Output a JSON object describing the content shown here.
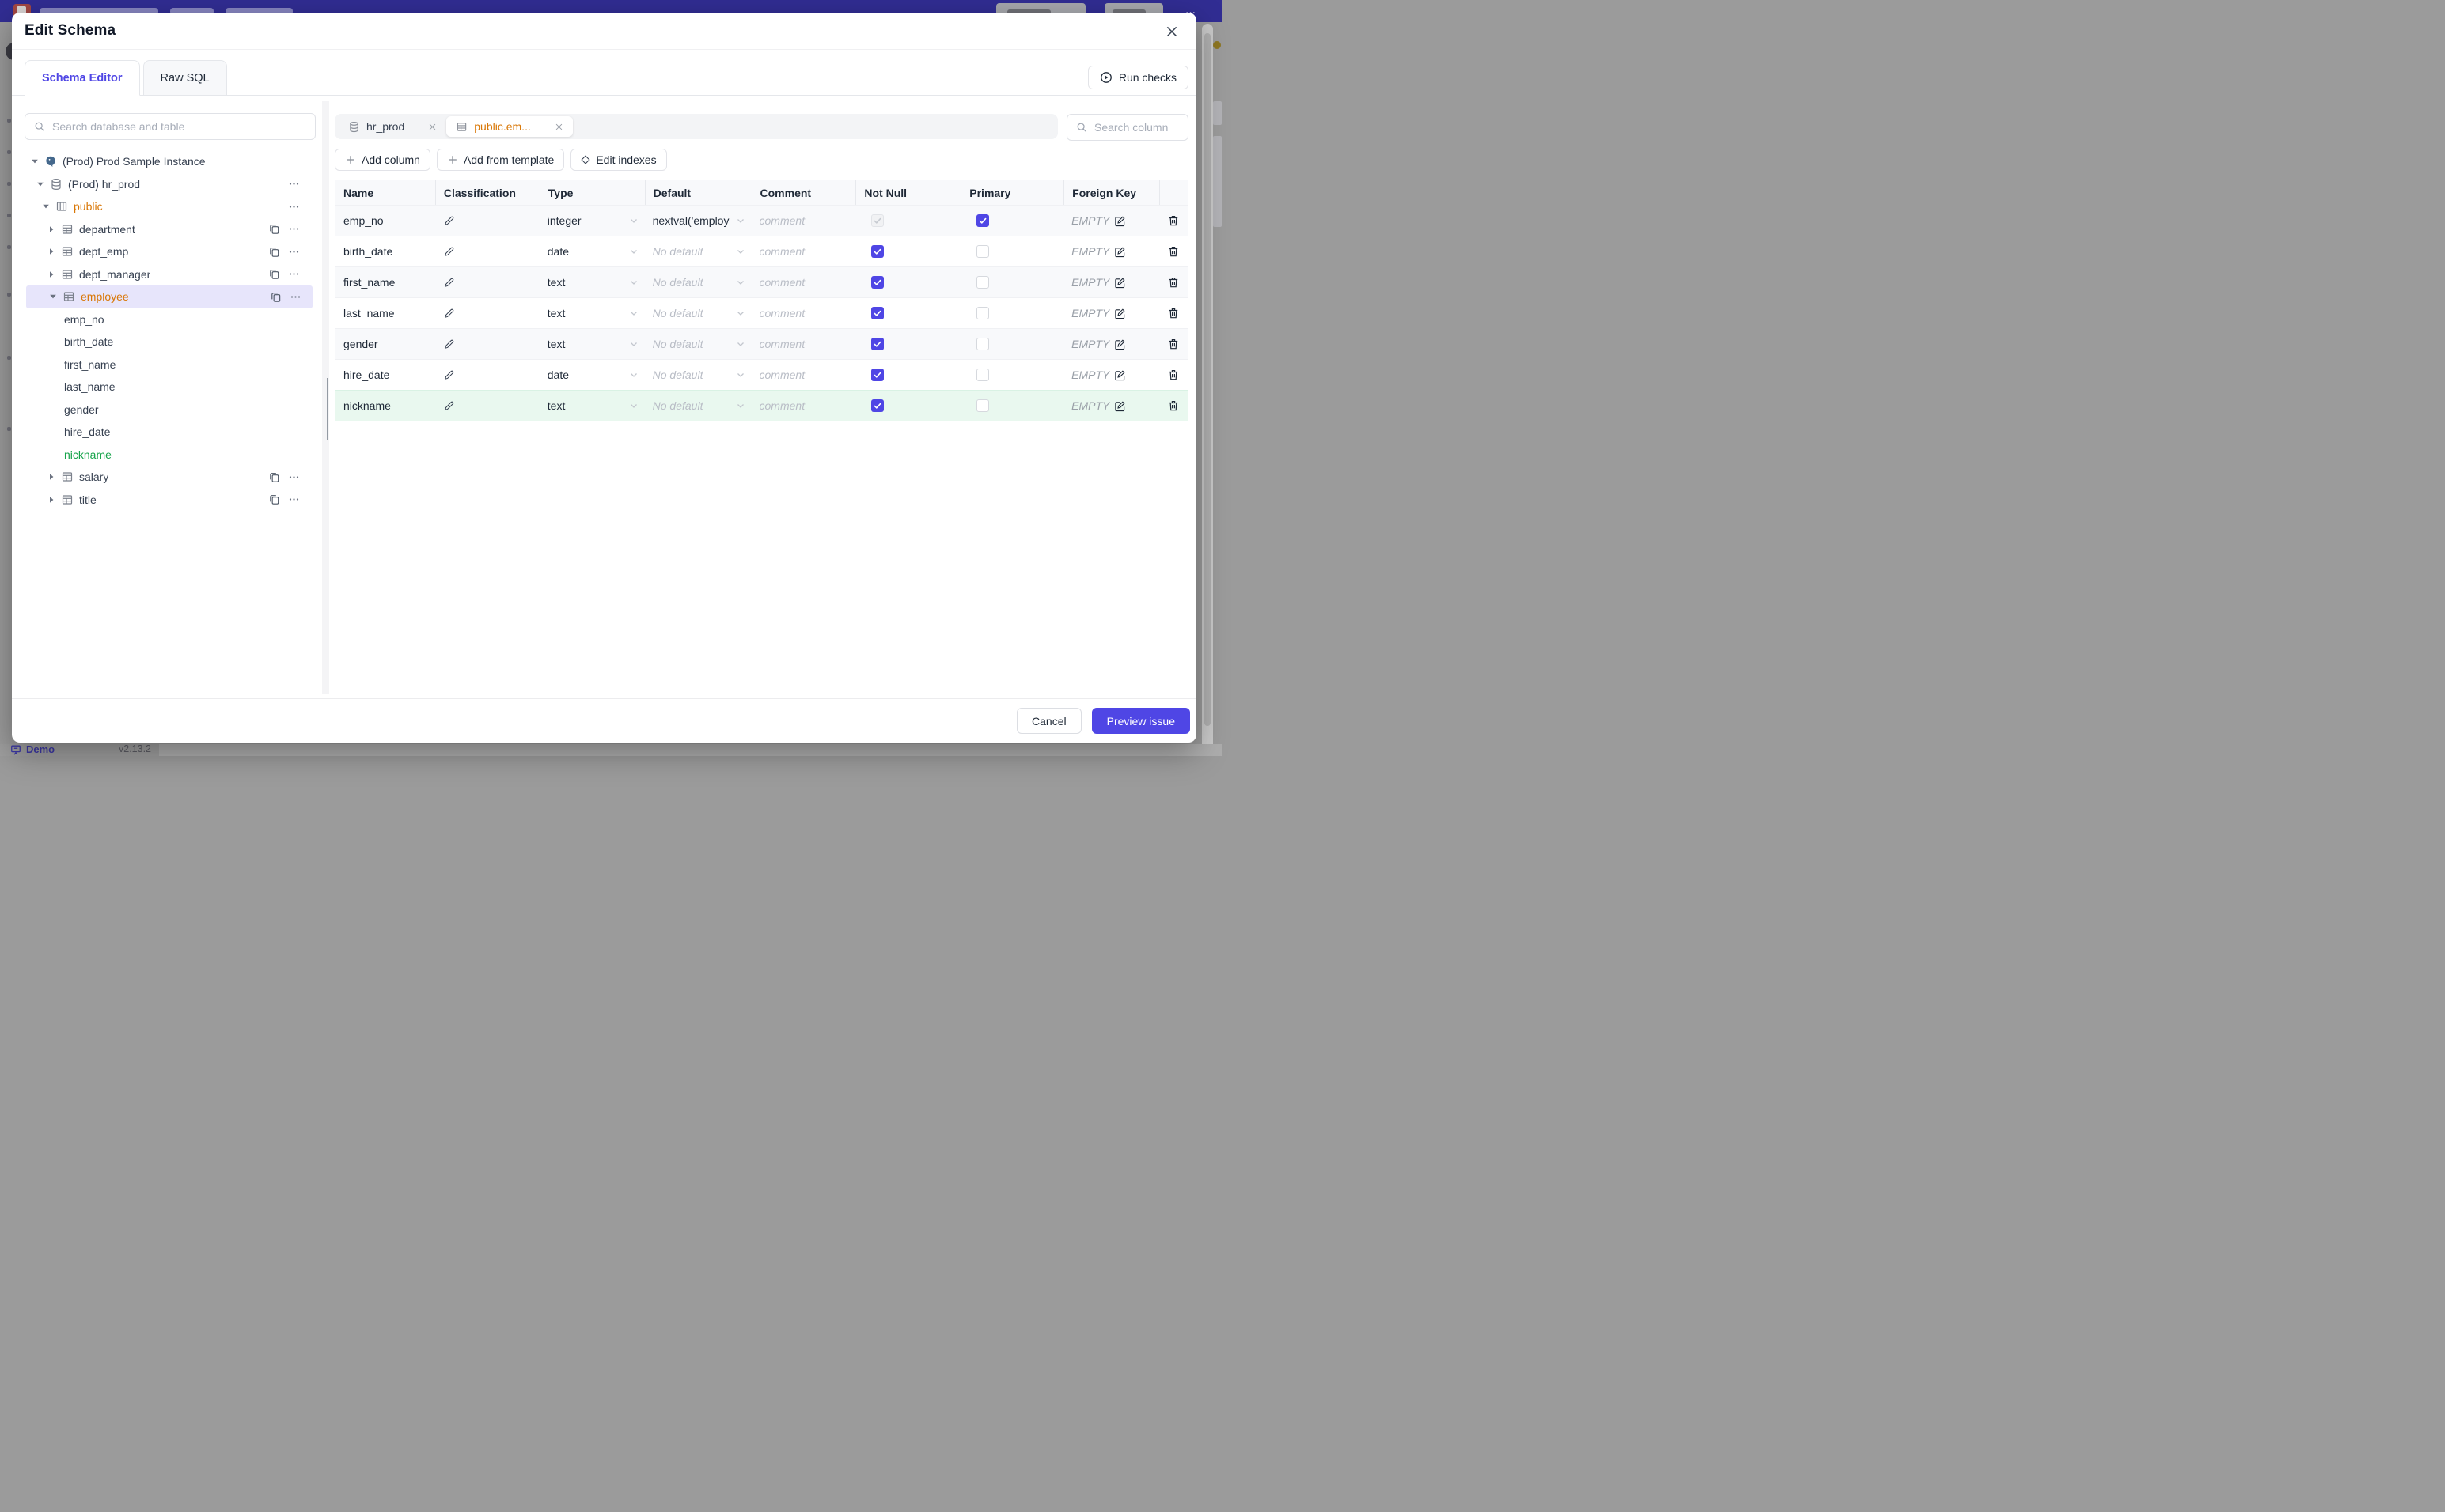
{
  "modal": {
    "title": "Edit Schema"
  },
  "modal_tabs": [
    {
      "label": "Schema Editor",
      "active": true
    },
    {
      "label": "Raw SQL",
      "active": false
    }
  ],
  "run_checks_label": "Run checks",
  "sidebar": {
    "search_placeholder": "Search database and table",
    "tree": [
      {
        "label": "(Prod) Prod Sample Instance",
        "level": 0,
        "icon": "postgres",
        "caret": "down",
        "copy": false,
        "dots": false,
        "color": "default",
        "selected": false,
        "column": false
      },
      {
        "label": "(Prod) hr_prod",
        "level": 1,
        "icon": "database",
        "caret": "down",
        "copy": false,
        "dots": true,
        "color": "default",
        "selected": false,
        "column": false
      },
      {
        "label": "public",
        "level": 2,
        "icon": "schema",
        "caret": "down",
        "copy": false,
        "dots": true,
        "color": "amber",
        "selected": false,
        "column": false
      },
      {
        "label": "department",
        "level": 3,
        "icon": "table",
        "caret": "right",
        "copy": true,
        "dots": true,
        "color": "default",
        "selected": false,
        "column": false
      },
      {
        "label": "dept_emp",
        "level": 3,
        "icon": "table",
        "caret": "right",
        "copy": true,
        "dots": true,
        "color": "default",
        "selected": false,
        "column": false
      },
      {
        "label": "dept_manager",
        "level": 3,
        "icon": "table",
        "caret": "right",
        "copy": true,
        "dots": true,
        "color": "default",
        "selected": false,
        "column": false
      },
      {
        "label": "employee",
        "level": 3,
        "icon": "table",
        "caret": "down",
        "copy": true,
        "dots": true,
        "color": "amber",
        "selected": true,
        "column": false
      },
      {
        "label": "emp_no",
        "level": 4,
        "icon": null,
        "caret": null,
        "copy": false,
        "dots": false,
        "color": "default",
        "selected": false,
        "column": true
      },
      {
        "label": "birth_date",
        "level": 4,
        "icon": null,
        "caret": null,
        "copy": false,
        "dots": false,
        "color": "default",
        "selected": false,
        "column": true
      },
      {
        "label": "first_name",
        "level": 4,
        "icon": null,
        "caret": null,
        "copy": false,
        "dots": false,
        "color": "default",
        "selected": false,
        "column": true
      },
      {
        "label": "last_name",
        "level": 4,
        "icon": null,
        "caret": null,
        "copy": false,
        "dots": false,
        "color": "default",
        "selected": false,
        "column": true
      },
      {
        "label": "gender",
        "level": 4,
        "icon": null,
        "caret": null,
        "copy": false,
        "dots": false,
        "color": "default",
        "selected": false,
        "column": true
      },
      {
        "label": "hire_date",
        "level": 4,
        "icon": null,
        "caret": null,
        "copy": false,
        "dots": false,
        "color": "default",
        "selected": false,
        "column": true
      },
      {
        "label": "nickname",
        "level": 4,
        "icon": null,
        "caret": null,
        "copy": false,
        "dots": false,
        "color": "green",
        "selected": false,
        "column": true
      },
      {
        "label": "salary",
        "level": 3,
        "icon": "table",
        "caret": "right",
        "copy": true,
        "dots": true,
        "color": "default",
        "selected": false,
        "column": false
      },
      {
        "label": "title",
        "level": 3,
        "icon": "table",
        "caret": "right",
        "copy": true,
        "dots": true,
        "color": "default",
        "selected": false,
        "column": false
      }
    ]
  },
  "editor": {
    "open_tabs": [
      {
        "label": "hr_prod",
        "icon": "database",
        "active": false
      },
      {
        "label": "public.em...",
        "icon": "table",
        "active": true
      }
    ],
    "toolbar": [
      {
        "label": "Add column",
        "icon": "plus"
      },
      {
        "label": "Add from template",
        "icon": "plus"
      },
      {
        "label": "Edit indexes",
        "icon": "diamond"
      }
    ],
    "column_search_placeholder": "Search column",
    "table": {
      "headers": [
        "Name",
        "Classification",
        "Type",
        "Default",
        "Comment",
        "Not Null",
        "Primary",
        "Foreign Key",
        ""
      ],
      "rows": [
        {
          "name": "emp_no",
          "type": "integer",
          "default_value": "nextval('employ",
          "default_placeholder": null,
          "comment_placeholder": "comment",
          "not_null_checked": true,
          "not_null_disabled": true,
          "primary_checked": true,
          "foreign_key": "EMPTY",
          "new": false
        },
        {
          "name": "birth_date",
          "type": "date",
          "default_value": null,
          "default_placeholder": "No default",
          "comment_placeholder": "comment",
          "not_null_checked": true,
          "not_null_disabled": false,
          "primary_checked": false,
          "foreign_key": "EMPTY",
          "new": false
        },
        {
          "name": "first_name",
          "type": "text",
          "default_value": null,
          "default_placeholder": "No default",
          "comment_placeholder": "comment",
          "not_null_checked": true,
          "not_null_disabled": false,
          "primary_checked": false,
          "foreign_key": "EMPTY",
          "new": false
        },
        {
          "name": "last_name",
          "type": "text",
          "default_value": null,
          "default_placeholder": "No default",
          "comment_placeholder": "comment",
          "not_null_checked": true,
          "not_null_disabled": false,
          "primary_checked": false,
          "foreign_key": "EMPTY",
          "new": false
        },
        {
          "name": "gender",
          "type": "text",
          "default_value": null,
          "default_placeholder": "No default",
          "comment_placeholder": "comment",
          "not_null_checked": true,
          "not_null_disabled": false,
          "primary_checked": false,
          "foreign_key": "EMPTY",
          "new": false
        },
        {
          "name": "hire_date",
          "type": "date",
          "default_value": null,
          "default_placeholder": "No default",
          "comment_placeholder": "comment",
          "not_null_checked": true,
          "not_null_disabled": false,
          "primary_checked": false,
          "foreign_key": "EMPTY",
          "new": false
        },
        {
          "name": "nickname",
          "type": "text",
          "default_value": null,
          "default_placeholder": "No default",
          "comment_placeholder": "comment",
          "not_null_checked": true,
          "not_null_disabled": false,
          "primary_checked": false,
          "foreign_key": "EMPTY",
          "new": true
        }
      ]
    }
  },
  "footer": {
    "cancel_label": "Cancel",
    "primary_label": "Preview issue"
  },
  "backdrop": {
    "demo_label": "Demo",
    "version": "v2.13.2"
  },
  "colors": {
    "accent": "#4f46e5",
    "table_name_accent": "#d97706",
    "new_column_green": "#16a34a",
    "new_row_bg": "#e9f8ef",
    "topbar": "#312d93"
  }
}
